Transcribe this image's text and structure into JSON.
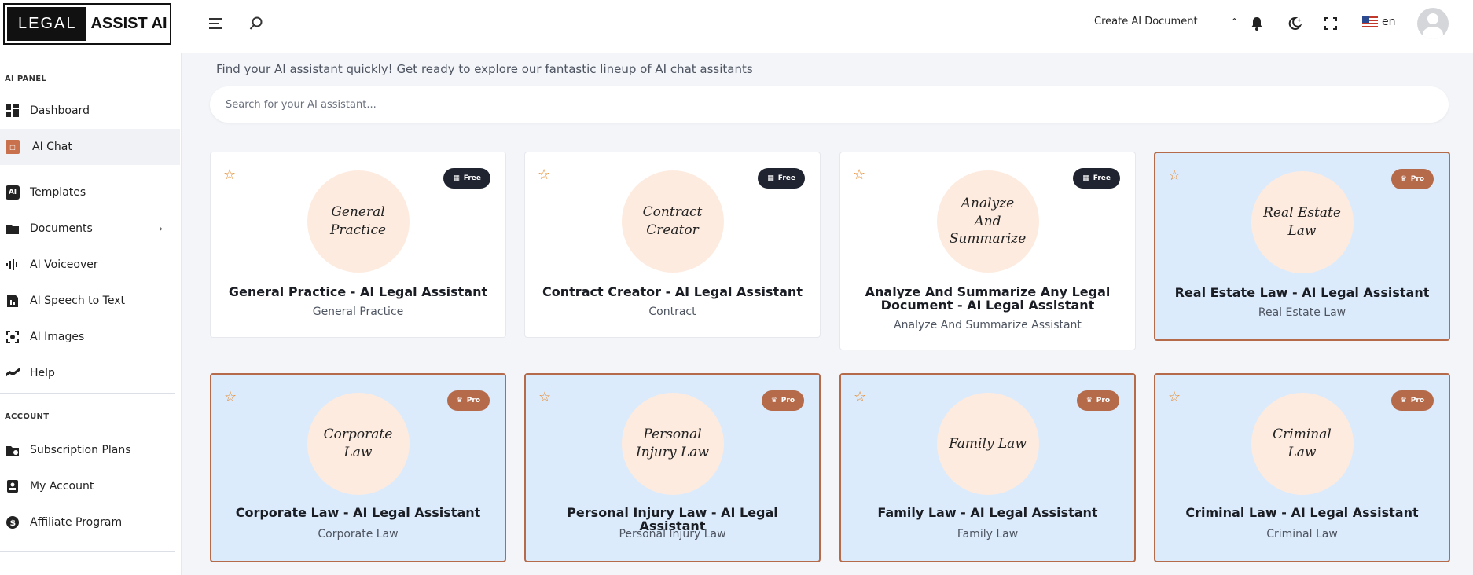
{
  "header": {
    "logo_left": "LEGAL",
    "logo_right": "ASSIST AI",
    "menu_icon": "menu-icon",
    "search_icon": "search-icon",
    "create_doc_label": "Create AI Document",
    "language": "en"
  },
  "sidebar": {
    "section_ai_panel": "AI PANEL",
    "items": [
      {
        "label": "Dashboard",
        "icon": "dashboard-icon"
      },
      {
        "label": "AI Chat",
        "icon": "chat-icon"
      },
      {
        "label": "Templates",
        "icon": "templates-icon"
      },
      {
        "label": "Documents",
        "icon": "folder-icon"
      },
      {
        "label": "AI Voiceover",
        "icon": "waveform-icon"
      },
      {
        "label": "AI Speech to Text",
        "icon": "speech-icon"
      },
      {
        "label": "AI Images",
        "icon": "image-icon"
      },
      {
        "label": "Help",
        "icon": "help-icon"
      }
    ],
    "section_account": "ACCOUNT",
    "account_items": [
      {
        "label": "Subscription Plans",
        "icon": "plans-icon"
      },
      {
        "label": "My Account",
        "icon": "account-icon"
      },
      {
        "label": "Affiliate Program",
        "icon": "dollar-icon"
      }
    ]
  },
  "main": {
    "intro": "Find your AI assistant quickly! Get ready to explore our fantastic lineup of AI chat assitants",
    "search_placeholder": "Search for your AI assistant...",
    "cards": [
      {
        "title": "General Practice - AI Legal Assistant",
        "subtitle": "General Practice",
        "script": "General Practice",
        "badge": "Free"
      },
      {
        "title": "Contract Creator - AI Legal Assistant",
        "subtitle": "Contract",
        "script": "Contract Creator",
        "badge": "Free"
      },
      {
        "title": "Analyze And Summarize Any Legal Document - AI Legal Assistant",
        "subtitle": "Analyze And Summarize Assistant",
        "script": "Analyze And Summarize",
        "badge": "Free"
      },
      {
        "title": "Real Estate Law - AI Legal Assistant",
        "subtitle": "Real Estate Law",
        "script": "Real Estate Law",
        "badge": "Pro"
      },
      {
        "title": "Corporate Law - AI Legal Assistant",
        "subtitle": "Corporate Law",
        "script": "Corporate Law",
        "badge": "Pro"
      },
      {
        "title": "Personal Injury Law - AI Legal Assistant",
        "subtitle": "Personal Injury Law",
        "script": "Personal Injury Law",
        "badge": "Pro"
      },
      {
        "title": "Family Law - AI Legal Assistant",
        "subtitle": "Family Law",
        "script": "Family Law",
        "badge": "Pro"
      },
      {
        "title": "Criminal Law - AI Legal Assistant",
        "subtitle": "Criminal Law",
        "script": "Criminal Law",
        "badge": "Pro"
      }
    ]
  },
  "colors": {
    "accent": "#b56a4a",
    "pro_bg": "#dcebfb",
    "circle_bg": "#fdebdf"
  }
}
